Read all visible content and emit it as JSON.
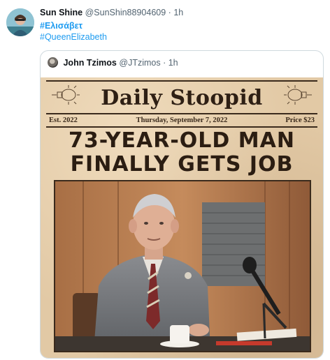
{
  "tweet": {
    "author_name": "Sun Shine",
    "author_handle": "@SunShin88904609",
    "separator": "·",
    "time": "1h",
    "hashtags": [
      "#Ελισάβετ",
      "#QueenElizabeth"
    ]
  },
  "quote": {
    "author_name": "John Tzimos",
    "author_handle": "@JTzimos",
    "separator": "·",
    "time": "1h",
    "newspaper": {
      "masthead": "Daily Stoopid",
      "established": "Est. 2022",
      "date": "Thursday, September 7, 2022",
      "price": "Price $23",
      "headline_line1": "73-YEAR-OLD MAN",
      "headline_line2": "FINALLY GETS JOB"
    }
  },
  "colors": {
    "link": "#1d9bf0",
    "muted": "#536471",
    "paper": "#e2c9a5",
    "ink": "#2b1d12"
  }
}
